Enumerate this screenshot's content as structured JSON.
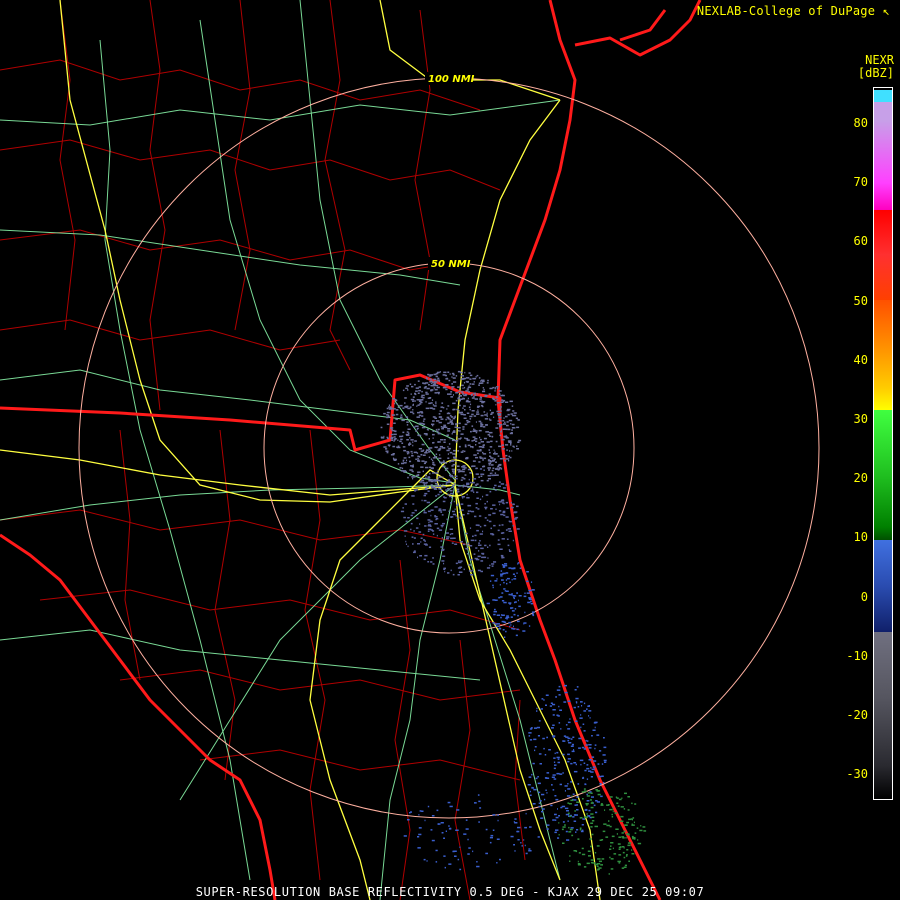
{
  "header": {
    "credit": "NEXLAB-College of DuPage",
    "credit_mark": "↖",
    "product": "NEXR",
    "units": "[dBZ]"
  },
  "legend": {
    "ticks": [
      "80",
      "70",
      "60",
      "50",
      "40",
      "30",
      "20",
      "10",
      "0",
      "-10",
      "-20",
      "-30"
    ]
  },
  "range_rings": {
    "inner_label": "50 NMI",
    "outer_label": "100 NMI"
  },
  "footer": {
    "caption": "SUPER-RESOLUTION BASE REFLECTIVITY 0.5 DEG - KJAX 29 DEC 25 09:07"
  },
  "colors": {
    "state_border": "#ff1a1a",
    "county_border": "#c80000",
    "highway_primary": "#ffff40",
    "highway_secondary": "#8fffb0",
    "range_ring": "#ffb0a0",
    "echo_light": "#6b6f9e",
    "echo_blue": "#3a5fcf"
  }
}
